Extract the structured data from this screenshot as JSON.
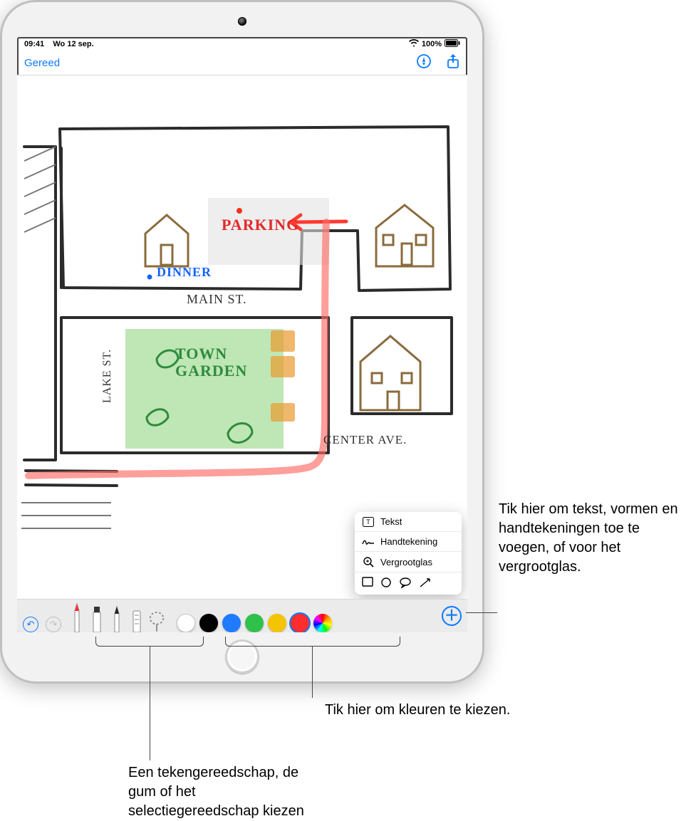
{
  "status": {
    "time": "09:41",
    "date": "Wo 12 sep.",
    "battery_pct": "100%"
  },
  "nav": {
    "done_label": "Gereed"
  },
  "map": {
    "parking": "PARKING",
    "dinner": "DINNER",
    "main_st": "MAIN ST.",
    "town_garden_l1": "TOWN",
    "town_garden_l2": "GARDEN",
    "lake_st": "LAKE ST.",
    "center_ave": "CENTER AVE."
  },
  "popup": {
    "items": {
      "text": "Tekst",
      "signature": "Handtekening",
      "loupe": "Vergrootglas"
    }
  },
  "toolbar": {
    "colors": {
      "white": "#ffffff",
      "black": "#000000",
      "blue": "#1f7bff",
      "green": "#30c14b",
      "yellow": "#f5c400",
      "red": "#ff2d2d"
    }
  },
  "callouts": {
    "add": "Tik hier om tekst, vormen en handtekeningen toe te voegen, of voor het vergrootglas.",
    "colors": "Tik hier om kleuren te kiezen.",
    "tools": "Een tekengereedschap, de gum of het selectiegereedschap kiezen"
  }
}
